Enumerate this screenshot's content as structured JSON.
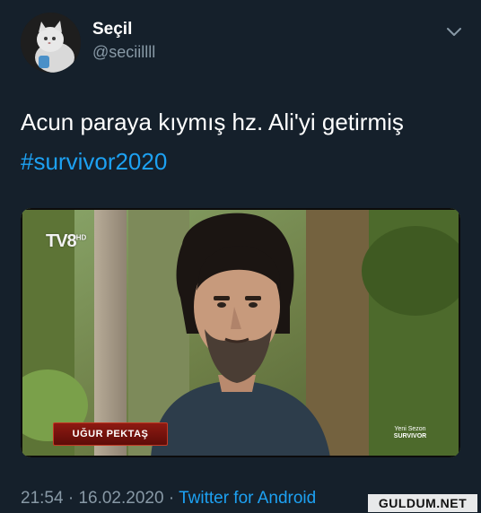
{
  "user": {
    "display_name": "Seçil",
    "handle": "@seciillll",
    "avatar_icon": "cat-avatar-icon"
  },
  "tweet": {
    "text": "Acun paraya kıymış hz. Ali'yi getirmiş",
    "hashtag": "#survivor2020"
  },
  "media": {
    "channel_logo": "TV8",
    "channel_logo_suffix": "HD",
    "name_banner": "UĞUR PEKTAŞ",
    "new_season_line1": "Yeni Sezon",
    "new_season_line2": "SURVIVOR"
  },
  "meta": {
    "time": "21:54",
    "separator": "·",
    "date": "16.02.2020",
    "source": "Twitter for Android"
  },
  "watermark": "GULDUM.NET",
  "colors": {
    "background": "#15202b",
    "text": "#ffffff",
    "secondary": "#8899a6",
    "accent": "#1da1f2"
  }
}
